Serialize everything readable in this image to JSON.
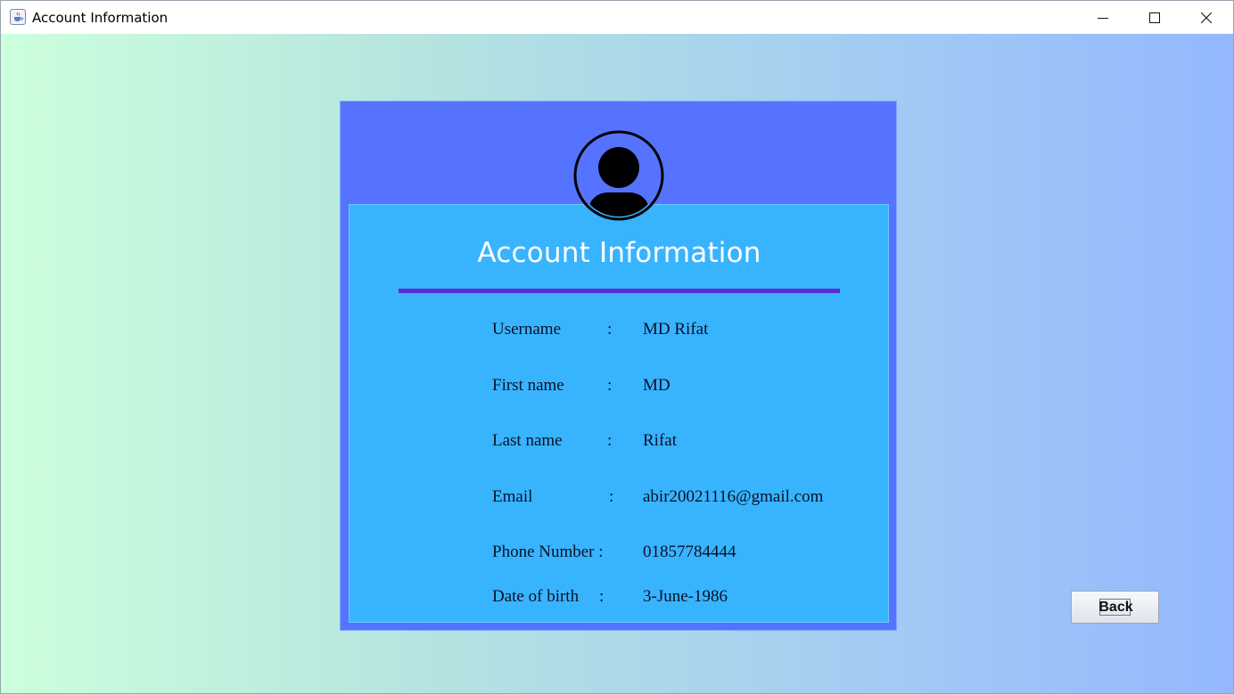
{
  "window": {
    "title": "Account Information",
    "icon": "java-cup-icon",
    "controls": [
      "minimize-icon",
      "maximize-icon",
      "close-icon"
    ]
  },
  "colors": {
    "background_left": "#ccffdc",
    "background_right": "#93b8ff",
    "card": "#5673ff",
    "card_inner": "#38b4ff",
    "divider": "#5a2bd8",
    "heading_text": "#ffffff"
  },
  "card": {
    "avatar_icon": "user-avatar-icon",
    "heading": "Account Information",
    "fields": [
      {
        "label": "Username",
        "colon": ":",
        "value": "MD Rifat"
      },
      {
        "label": "First name",
        "colon": ":",
        "value": "MD"
      },
      {
        "label": "Last name",
        "colon": ":",
        "value": "Rifat"
      },
      {
        "label": "Email",
        "colon": ":",
        "value": "abir20021116@gmail.com"
      },
      {
        "label": "Phone Number :",
        "colon": "",
        "value": "01857784444"
      },
      {
        "label": "Date of birth",
        "colon": ":",
        "value": "3-June-1986"
      }
    ]
  },
  "actions": {
    "back_label": "Back"
  }
}
